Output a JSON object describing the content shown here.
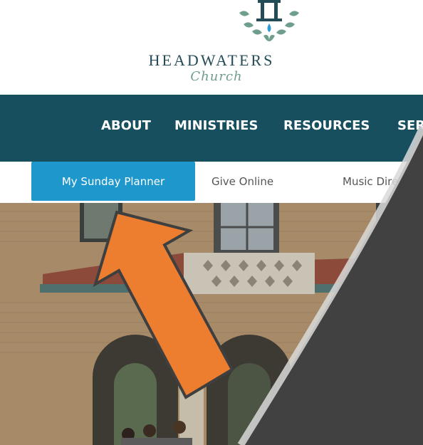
{
  "logo": {
    "wordmark": "HEADWATERS",
    "subtitle": "Church"
  },
  "nav": {
    "items": [
      {
        "label": "ABOUT"
      },
      {
        "label": "MINISTRIES"
      },
      {
        "label": "RESOURCES"
      },
      {
        "label": "SER"
      }
    ]
  },
  "subnav": {
    "primary": "My Sunday Planner",
    "links": [
      {
        "label": "Give Online"
      },
      {
        "label": "Music Direc"
      }
    ]
  },
  "colors": {
    "nav_bg": "#174f5f",
    "button_bg": "#1e98cc",
    "arrow": "#ee7e2f",
    "overlay_dark": "#414141"
  }
}
